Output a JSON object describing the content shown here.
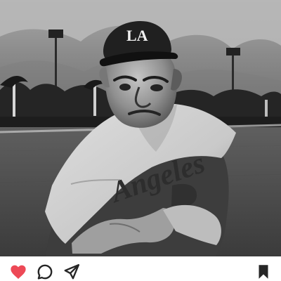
{
  "post": {
    "photo": {
      "cap_logo_text": "LA",
      "jersey_text": "Angeles"
    },
    "actions": {
      "like_icon": "heart-icon",
      "like_state": "liked",
      "like_color": "#ED4956",
      "comment_icon": "comment-icon",
      "share_icon": "share-icon",
      "save_icon": "bookmark-icon",
      "save_state": "saved",
      "icon_color": "#262626"
    }
  }
}
